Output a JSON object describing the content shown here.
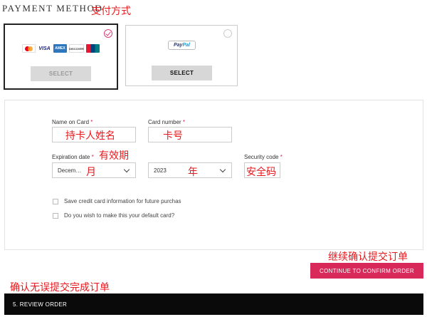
{
  "header": {
    "title": "PAYMENT METHOD"
  },
  "annotations": {
    "payment_method": "支付方式",
    "cardholder_name": "持卡人姓名",
    "card_number": "卡号",
    "expiry": "有效期",
    "month": "月",
    "year": "年",
    "security_code": "安全码",
    "continue": "继续确认提交订单",
    "review": "确认无误提交完成订单"
  },
  "payment_options": {
    "credit": {
      "select_label": "SELECT",
      "logos": [
        "mastercard",
        "VISA",
        "AMEX",
        "DISCOVER",
        "UnionPay"
      ]
    },
    "paypal": {
      "select_label": "SELECT",
      "logo_pay": "Pay",
      "logo_pal": "Pal"
    }
  },
  "form": {
    "name_label": "Name on Card",
    "card_number_label": "Card number",
    "expiry_label": "Expiration date",
    "security_label": "Security code",
    "required_mark": "*",
    "month_value": "Decem…",
    "year_value": "2023",
    "save_card_label": "Save credit card information for future purchas",
    "default_card_label": "Do you wish to make this your default card?"
  },
  "actions": {
    "continue_label": "CONTINUE TO CONFIRM ORDER"
  },
  "review": {
    "label": "5. REVIEW ORDER"
  },
  "colors": {
    "accent": "#d9285a",
    "annotation": "#e8191e",
    "review_bar": "#0a0a0a"
  }
}
